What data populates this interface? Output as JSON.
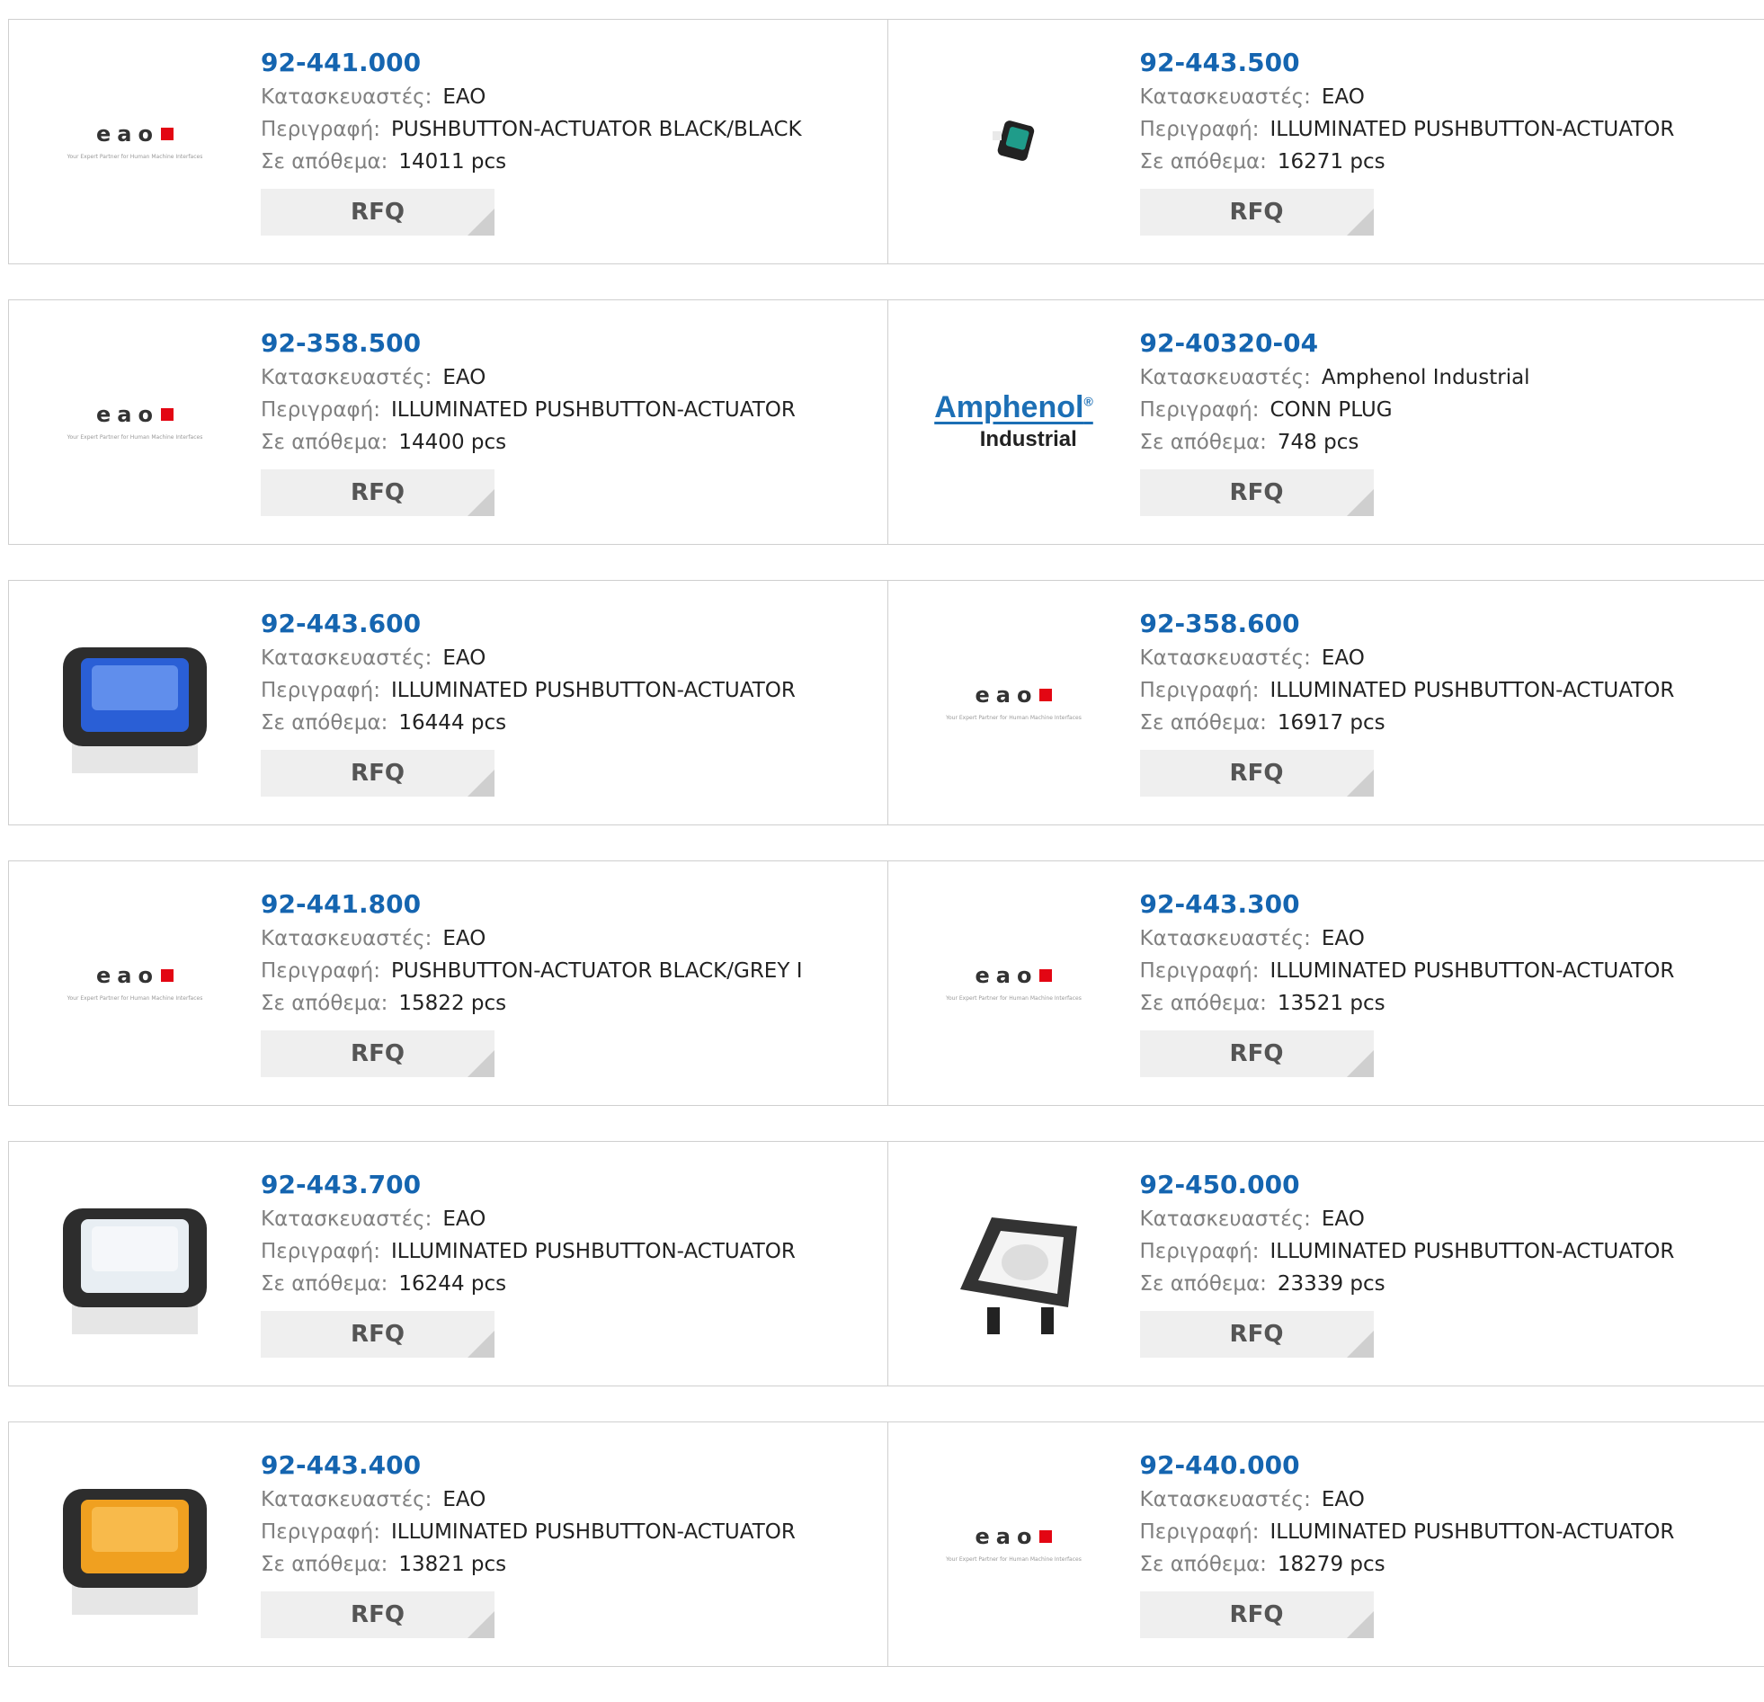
{
  "labels": {
    "manufacturer": "Κατασκευαστές:",
    "description": "Περιγραφή:",
    "stock": "Σε απόθεμα:",
    "rfq": "RFQ"
  },
  "eao_logo": {
    "word": "eao",
    "tagline": "Your Expert Partner for Human Machine Interfaces"
  },
  "amphenol_logo": {
    "word": "Amphenol",
    "sub": "Industrial"
  },
  "products": [
    {
      "part": "92-441.000",
      "manufacturer": "EAO",
      "description": "PUSHBUTTON-ACTUATOR BLACK/BLACK",
      "stock": "14011 pcs",
      "image": "eao-logo"
    },
    {
      "part": "92-443.500",
      "manufacturer": "EAO",
      "description": "ILLUMINATED PUSHBUTTON-ACTUATOR",
      "stock": "16271 pcs",
      "image": "green-actuator-small"
    },
    {
      "part": "92-358.500",
      "manufacturer": "EAO",
      "description": "ILLUMINATED PUSHBUTTON-ACTUATOR",
      "stock": "14400 pcs",
      "image": "eao-logo"
    },
    {
      "part": "92-40320-04",
      "manufacturer": "Amphenol Industrial",
      "description": "CONN PLUG",
      "stock": "748 pcs",
      "image": "amphenol-logo"
    },
    {
      "part": "92-443.600",
      "manufacturer": "EAO",
      "description": "ILLUMINATED PUSHBUTTON-ACTUATOR",
      "stock": "16444 pcs",
      "image": "blue-actuator"
    },
    {
      "part": "92-358.600",
      "manufacturer": "EAO",
      "description": "ILLUMINATED PUSHBUTTON-ACTUATOR",
      "stock": "16917 pcs",
      "image": "eao-logo"
    },
    {
      "part": "92-441.800",
      "manufacturer": "EAO",
      "description": "PUSHBUTTON-ACTUATOR BLACK/GREY I",
      "stock": "15822 pcs",
      "image": "eao-logo"
    },
    {
      "part": "92-443.300",
      "manufacturer": "EAO",
      "description": "ILLUMINATED PUSHBUTTON-ACTUATOR",
      "stock": "13521 pcs",
      "image": "eao-logo"
    },
    {
      "part": "92-443.700",
      "manufacturer": "EAO",
      "description": "ILLUMINATED PUSHBUTTON-ACTUATOR",
      "stock": "16244 pcs",
      "image": "white-actuator"
    },
    {
      "part": "92-450.000",
      "manufacturer": "EAO",
      "description": "ILLUMINATED PUSHBUTTON-ACTUATOR",
      "stock": "23339 pcs",
      "image": "open-actuator-housing"
    },
    {
      "part": "92-443.400",
      "manufacturer": "EAO",
      "description": "ILLUMINATED PUSHBUTTON-ACTUATOR",
      "stock": "13821 pcs",
      "image": "yellow-actuator"
    },
    {
      "part": "92-440.000",
      "manufacturer": "EAO",
      "description": "ILLUMINATED PUSHBUTTON-ACTUATOR",
      "stock": "18279 pcs",
      "image": "eao-logo"
    }
  ],
  "colors": {
    "part_link": "#1565b0",
    "border": "#cfcfcf",
    "rfq_bg": "#efefef",
    "eao_red": "#e30613",
    "amphenol_blue": "#1c6fb5"
  }
}
